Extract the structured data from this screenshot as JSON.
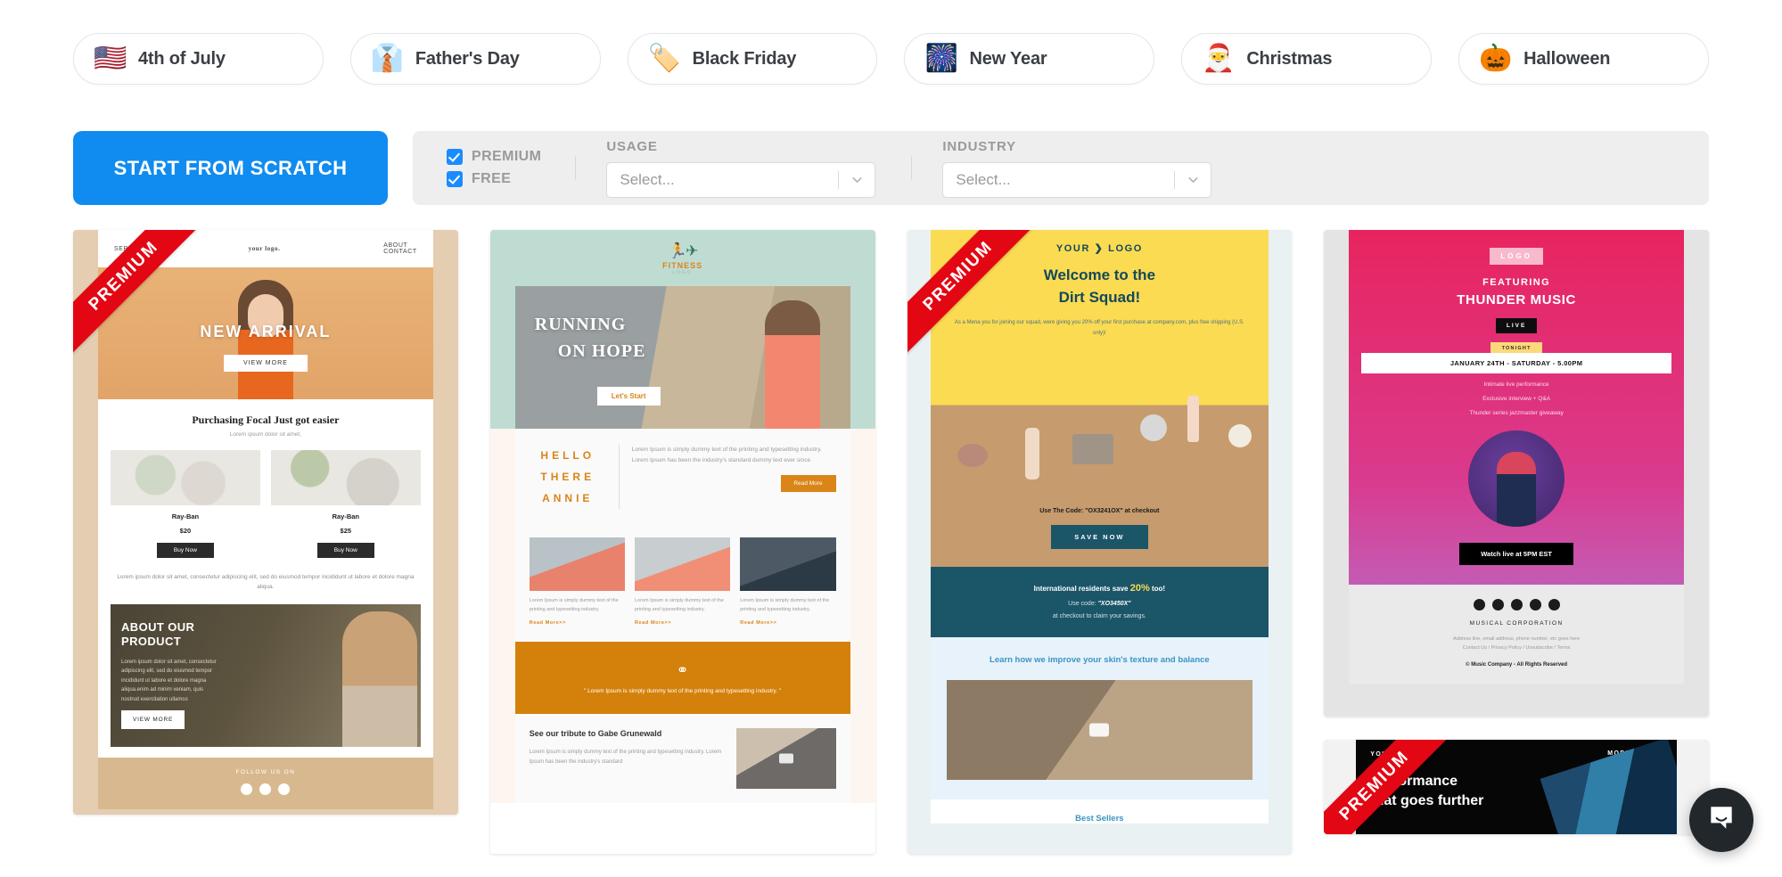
{
  "holiday_chips": [
    {
      "label": "4th of July",
      "icon": "us-flag-icon",
      "emoji": "🇺🇸"
    },
    {
      "label": "Father's Day",
      "icon": "man-in-suit-icon",
      "emoji": "👔"
    },
    {
      "label": "Black Friday",
      "icon": "black-friday-icon",
      "emoji": "🏷️"
    },
    {
      "label": "New Year",
      "icon": "fireworks-icon",
      "emoji": "🎆"
    },
    {
      "label": "Christmas",
      "icon": "santa-icon",
      "emoji": "🎅"
    },
    {
      "label": "Halloween",
      "icon": "jack-o-lantern-icon",
      "emoji": "🎃"
    }
  ],
  "filters": {
    "scratch_button": "START FROM SCRATCH",
    "checkboxes": [
      {
        "label": "PREMIUM",
        "checked": true
      },
      {
        "label": "FREE",
        "checked": true
      }
    ],
    "usage": {
      "label": "USAGE",
      "value": "Select...",
      "placeholder": "Select..."
    },
    "industry": {
      "label": "INDUSTRY",
      "value": "Select...",
      "placeholder": "Select..."
    }
  },
  "colors": {
    "accent_blue": "#108cf0",
    "checkbox_blue": "#1a8cff",
    "ribbon_red": "#e30613",
    "panel_gray": "#eeeeee"
  },
  "badges": {
    "premium": "PREMIUM"
  },
  "templates": [
    {
      "id": "new-arrival",
      "premium": true,
      "nav": {
        "left": "SERVICE",
        "logo": "your logo.",
        "right_1": "ABOUT",
        "right_2": "CONTACT"
      },
      "hero_title": "NEW ARRIVAL",
      "hero_button": "VIEW MORE",
      "section_title": "Purchasing Focal Just got easier",
      "section_sub": "Lorem ipsum dolor sit amet,",
      "products": [
        {
          "name": "Ray-Ban",
          "price": "$20",
          "button": "Buy Now"
        },
        {
          "name": "Ray-Ban",
          "price": "$25",
          "button": "Buy Now"
        }
      ],
      "paragraph": "Lorem ipsum dolor sit amet, consectetur adipiscing elit, sed do eiusmod tempor incididunt ut labore et dolore magna aliqua.",
      "about_title": "ABOUT OUR PRODUCT",
      "about_text": "Lorem ipsum dolor sit amet, consectetur adipiscing elit, sed do eiusmod tempor incididunt ut labore et dolore magna aliqua.enim ad minim veniam, quis nostrud exercitation ullamco",
      "about_button": "VIEW MORE",
      "footer_text": "FOLLOW US ON"
    },
    {
      "id": "fitness",
      "premium": false,
      "logo_text": "FITNESS",
      "logo_sub": "LOGO",
      "hero_line1": "RUNNING",
      "hero_line2": "ON HOPE",
      "hero_button": "Let's Start",
      "hello": "HELLO THERE ANNIE",
      "hello_body": "Lorem Ipsum is simply dummy text of the printing and typesetting industry. Lorem Ipsum has been the industry's standard dummy text ever since",
      "read_more": "Read More",
      "tiles": [
        {
          "text": "Lorem Ipsum is simply dummy text of the printing and typesetting industry.",
          "link": "Read More>>"
        },
        {
          "text": "Lorem Ipsum is simply dummy text of the printing and typesetting industry.",
          "link": "Read More>>"
        },
        {
          "text": "Lorem Ipsum is simply dummy text of the printing and typesetting industry.",
          "link": "Read More>>"
        }
      ],
      "quote": "\" Lorem Ipsum is simply dummy text of the printing and typesetting industry. \"",
      "tribute_title": "See our tribute to Gabe Grunewald",
      "tribute_text": "Lorem Ipsum is simply dummy text of the printing and typesetting industry. Lorem Ipsum has been the industry's standard"
    },
    {
      "id": "dirt-squad",
      "premium": true,
      "logo": "YOUR ❯ LOGO",
      "headline_1": "Welcome to the",
      "headline_2": "Dirt Squad!",
      "intro": "As a Mena you for joining our squad, were giving you 20% off your first purchase at company.com, plus free shipping (U.S. only)!",
      "code_line": "Use The Code:  \"OX3241OX\" at checkout",
      "save_button": "SAVE NOW",
      "intl_line1_pre": "International residents save ",
      "intl_percent": "20%",
      "intl_line1_post": " too!",
      "intl_line2_pre": "Use code:  ",
      "intl_code": "\"XO3450X\"",
      "intl_line3": "at checkout to claim your savings.",
      "learn_title": "Learn how we improve your skin's texture and balance",
      "best_sellers": "Best Sellers"
    },
    {
      "id": "thunder-music",
      "premium": false,
      "logo": "LOGO",
      "featuring": "FEATURING",
      "artist": "THUNDER MUSIC",
      "live_badge": "LIVE",
      "tonight_badge": "TONIGHT",
      "date_line": "JANUARY 24TH - SATURDAY - 5.00PM",
      "bullets": [
        "Intimate live performance",
        "Exclusive interview + Q&A",
        "Thunder series jazzmaster giveaway"
      ],
      "watch_button": "Watch live at 5PM EST",
      "company": "MUSICAL  CORPORATION",
      "address": "Address line, email address, phone number, etc goes here",
      "links": "Contact Us / Privacy Policy / Unsubscribe / Terms",
      "rights": "© Music Company  -  All Rights Reserved",
      "social": [
        "facebook-icon",
        "twitter-icon",
        "linkedin-icon",
        "instagram-icon",
        "youtube-icon"
      ]
    },
    {
      "id": "performance",
      "premium": true,
      "logo": "YOUR ❯ LOGO",
      "model": "MODEL NAME",
      "headline_1": "Performance",
      "headline_2": "that goes further"
    }
  ],
  "chat": {
    "icon": "chat-bubble-icon",
    "label": "Open chat"
  }
}
